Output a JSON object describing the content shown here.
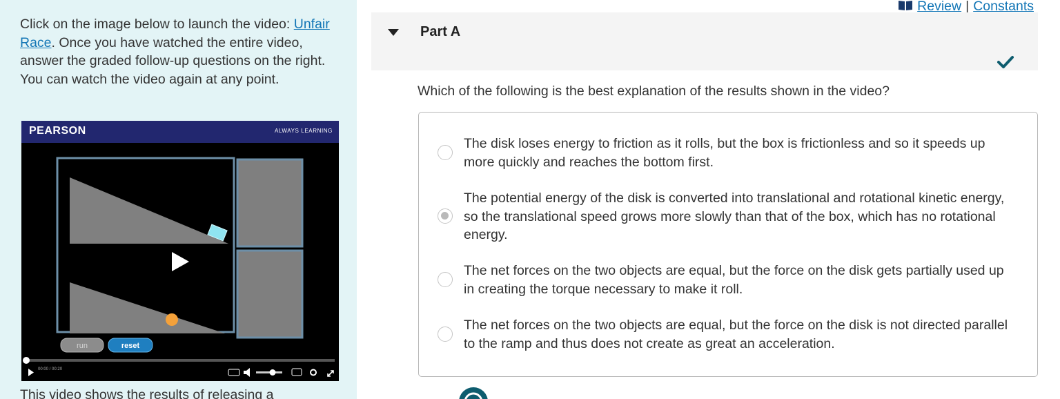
{
  "intro": {
    "text_before": "Click on the image below to launch the video: ",
    "link": "Unfair Race",
    "text_after": ". Once you have watched the entire video, answer the graded follow-up questions on the right. You can watch the video again at any point."
  },
  "video": {
    "brand": "PEARSON",
    "tagline": "ALWAYS LEARNING",
    "run_label": "run",
    "reset_label": "reset",
    "time": "00:00 / 00:20"
  },
  "tail_text": "This video shows the results of releasing a",
  "header": {
    "review": "Review",
    "constants": "Constants",
    "separator": "|"
  },
  "part": {
    "title": "Part A",
    "status": "correct"
  },
  "question": "Which of the following is the best explanation of the results shown in the video?",
  "choices": [
    {
      "text": "The disk loses energy to friction as it rolls, but the box is frictionless and so it speeds up more quickly and reaches the bottom first.",
      "selected": false
    },
    {
      "text": "The potential energy of the disk is converted into translational and rotational kinetic energy, so the translational speed grows more slowly than that of the box, which has no rotational energy.",
      "selected": true
    },
    {
      "text": "The net forces on the two objects are equal, but the force on the disk gets partially used up in creating the torque necessary to make it roll.",
      "selected": false
    },
    {
      "text": "The net forces on the two objects are equal, but the force on the disk is not directed parallel to the ramp and thus does not create as great an acceleration.",
      "selected": false
    }
  ],
  "colors": {
    "link": "#1376b6",
    "check": "#0d5c6e",
    "panel_bg": "#e3f4f6",
    "pearson_navy": "#22276f"
  }
}
